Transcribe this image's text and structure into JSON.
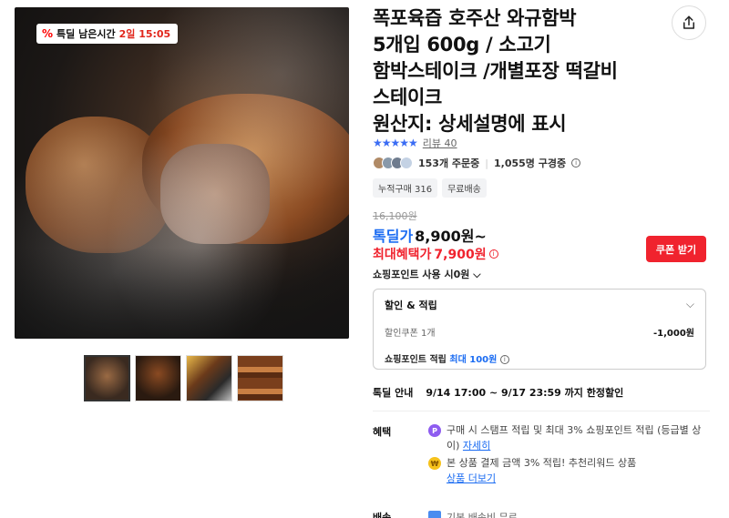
{
  "deal_badge": {
    "icon": "percent-icon",
    "prefix": "특딜 남은시간",
    "time": "2일 15:05"
  },
  "product": {
    "title_lines": [
      "폭포육즙 호주산 와규함박",
      "5개입 600g / 소고기",
      "함박스테이크 /개별포장 떡갈비",
      "스테이크",
      "원산지: 상세설명에 표시"
    ],
    "rating_stars": "★★★★★",
    "review_label": "리뷰 40",
    "orders": "153개 주문중",
    "subscribers": "1,055명 구경중",
    "tags": [
      "누적구매 316",
      "무료배송"
    ]
  },
  "pricing": {
    "original": "16,100원",
    "deal_label": "톡딜가",
    "deal_price": "8,900원~",
    "max_label": "최대혜택가",
    "max_price": "7,900원",
    "coupon_button": "쿠폰 받기",
    "points_use": "쇼핑포인트 사용 시0원"
  },
  "discount_box": {
    "title": "할인 & 적립",
    "coupon_label": "할인쿠폰 1개",
    "coupon_value": "-1,000원",
    "point_prefix": "쇼핑포인트 적립",
    "point_highlight": "최대 100원"
  },
  "notice": {
    "label": "톡딜 안내",
    "text": "9/14 17:00 ~ 9/17 23:59 까지 한정할인"
  },
  "benefits": {
    "label": "혜택",
    "item1_text": "구매 시 스탬프 적립 및 최대 3% 쇼핑포인트 적립 (등급별 상이)",
    "item1_link": "자세히",
    "item2_text": "본 상품 결제 금액 3% 적립! 추천리워드 상품",
    "item2_link": "상품 더보기"
  },
  "shipping": {
    "label": "배송",
    "text": "기본 배송비 무료"
  },
  "colors": {
    "accent_blue": "#1b6cf2",
    "accent_red": "#f0232e"
  }
}
